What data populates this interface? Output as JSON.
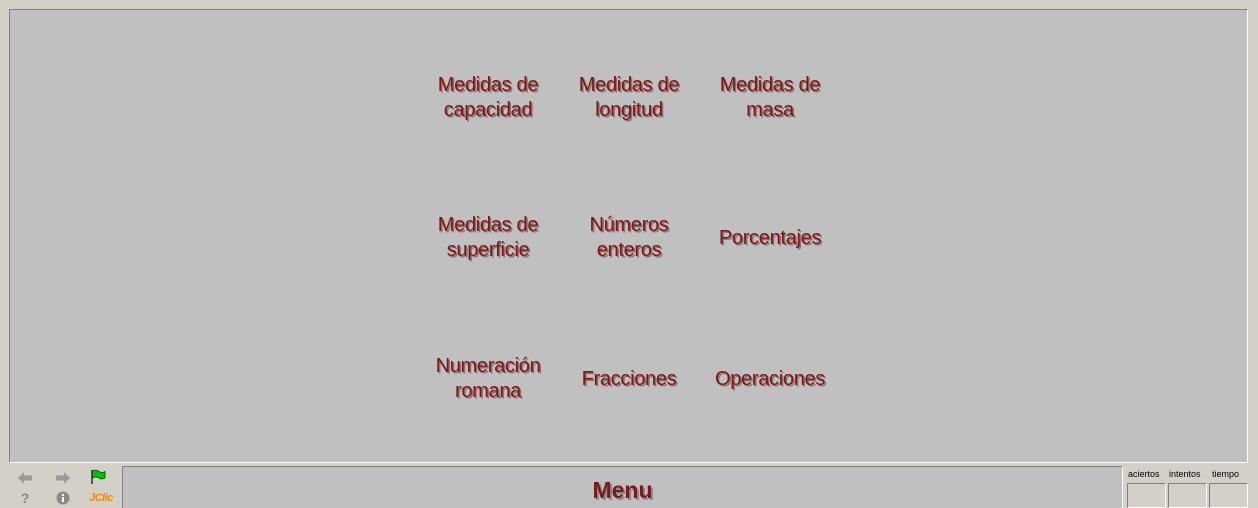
{
  "menu": {
    "items": [
      {
        "line1": "Medidas de",
        "line2": "capacidad"
      },
      {
        "line1": "Medidas de",
        "line2": "longitud"
      },
      {
        "line1": "Medidas de",
        "line2": "masa"
      },
      {
        "line1": "Medidas de",
        "line2": "superficie"
      },
      {
        "line1": "Números",
        "line2": "enteros"
      },
      {
        "line1": "Porcentajes",
        "line2": ""
      },
      {
        "line1": "Numeración",
        "line2": "romana"
      },
      {
        "line1": "Fracciones",
        "line2": ""
      },
      {
        "line1": "Operaciones",
        "line2": ""
      }
    ]
  },
  "toolbar": {
    "prev_icon": "arrow-left-icon",
    "next_icon": "arrow-right-icon",
    "restart_icon": "green-flag-icon",
    "help_glyph": "?",
    "info_glyph": "i",
    "logo_text": "JClic"
  },
  "title": "Menu",
  "counters": {
    "aciertos": "aciertos",
    "intentos": "intentos",
    "tiempo": "tiempo"
  },
  "colors": {
    "item_text": "#8b1010",
    "title_text": "#7a1a1a",
    "stage_bg": "#c0c0c0",
    "logo": "#f08a00",
    "flag": "#00c000"
  }
}
